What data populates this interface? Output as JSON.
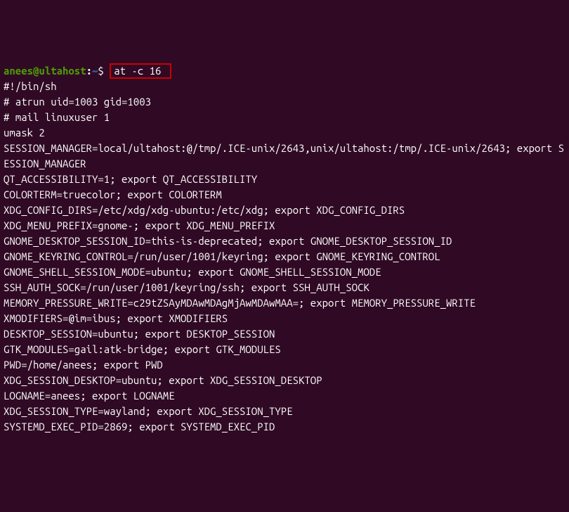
{
  "prompt": {
    "user_host": "anees@ultahost",
    "colon": ":",
    "path": "~",
    "dollar": "$",
    "command": "at -c 16"
  },
  "output": {
    "l0": "#!/bin/sh",
    "l1": "# atrun uid=1003 gid=1003",
    "l2": "# mail linuxuser 1",
    "l3": "umask 2",
    "l4": "SESSION_MANAGER=local/ultahost:@/tmp/.ICE-unix/2643,unix/ultahost:/tmp/.ICE-unix/2643; export SESSION_MANAGER",
    "l5": "QT_ACCESSIBILITY=1; export QT_ACCESSIBILITY",
    "l6": "COLORTERM=truecolor; export COLORTERM",
    "l7": "XDG_CONFIG_DIRS=/etc/xdg/xdg-ubuntu:/etc/xdg; export XDG_CONFIG_DIRS",
    "l8": "XDG_MENU_PREFIX=gnome-; export XDG_MENU_PREFIX",
    "l9": "GNOME_DESKTOP_SESSION_ID=this-is-deprecated; export GNOME_DESKTOP_SESSION_ID",
    "l10": "GNOME_KEYRING_CONTROL=/run/user/1001/keyring; export GNOME_KEYRING_CONTROL",
    "l11": "GNOME_SHELL_SESSION_MODE=ubuntu; export GNOME_SHELL_SESSION_MODE",
    "l12": "SSH_AUTH_SOCK=/run/user/1001/keyring/ssh; export SSH_AUTH_SOCK",
    "l13": "MEMORY_PRESSURE_WRITE=c29tZSAyMDAwMDAgMjAwMDAwMAA=; export MEMORY_PRESSURE_WRITE",
    "l14": "XMODIFIERS=@im=ibus; export XMODIFIERS",
    "l15": "DESKTOP_SESSION=ubuntu; export DESKTOP_SESSION",
    "l16": "GTK_MODULES=gail:atk-bridge; export GTK_MODULES",
    "l17": "PWD=/home/anees; export PWD",
    "l18": "XDG_SESSION_DESKTOP=ubuntu; export XDG_SESSION_DESKTOP",
    "l19": "LOGNAME=anees; export LOGNAME",
    "l20": "XDG_SESSION_TYPE=wayland; export XDG_SESSION_TYPE",
    "l21": "SYSTEMD_EXEC_PID=2869; export SYSTEMD_EXEC_PID"
  }
}
